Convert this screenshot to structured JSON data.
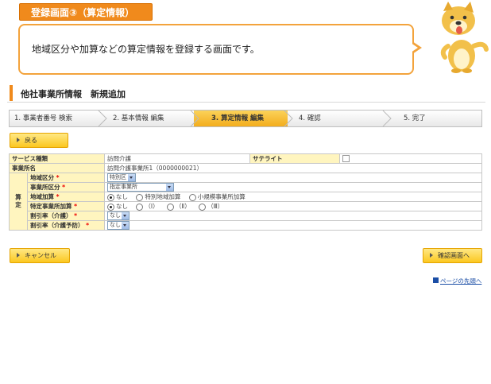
{
  "banner": {
    "title": "登録画面③（算定情報）",
    "description": "地域区分や加算などの算定情報を登録する画面です。"
  },
  "page": {
    "heading": "他社事業所情報　新規追加"
  },
  "steps": [
    {
      "label": "1. 事業者番号 検索"
    },
    {
      "label": "2. 基本情報 編集"
    },
    {
      "label": "3. 算定情報 編集"
    },
    {
      "label": "4. 確認"
    },
    {
      "label": "5. 完了"
    }
  ],
  "buttons": {
    "back": "戻る",
    "cancel": "キャンセル",
    "confirm": "確認画面へ"
  },
  "form": {
    "service_type": {
      "label": "サービス種類",
      "value": "訪問介護"
    },
    "satellite": {
      "label": "サテライト"
    },
    "office_name": {
      "label": "事業所名",
      "value": "訪問介護事業所1（0000000021）"
    },
    "group_label": "算定",
    "region": {
      "label": "地域区分",
      "required": "*",
      "value": "特別区"
    },
    "office_class": {
      "label": "事業所区分",
      "required": "*",
      "value": "指定事業所"
    },
    "region_addition": {
      "label": "地域加算",
      "required": "*",
      "options": [
        "なし",
        "特別地域加算",
        "小規模事業所加算"
      ]
    },
    "specific_addition": {
      "label": "特定事業所加算",
      "required": "*",
      "options": [
        "なし",
        "（Ⅰ）",
        "（Ⅱ）",
        "（Ⅲ）"
      ]
    },
    "discount_care": {
      "label": "割引率（介護）",
      "required": "*",
      "value": "なし"
    },
    "discount_prevention": {
      "label": "割引率（介護予防）",
      "required": "*",
      "value": "なし"
    }
  },
  "footer": {
    "page_top": "ページの先頭へ"
  }
}
